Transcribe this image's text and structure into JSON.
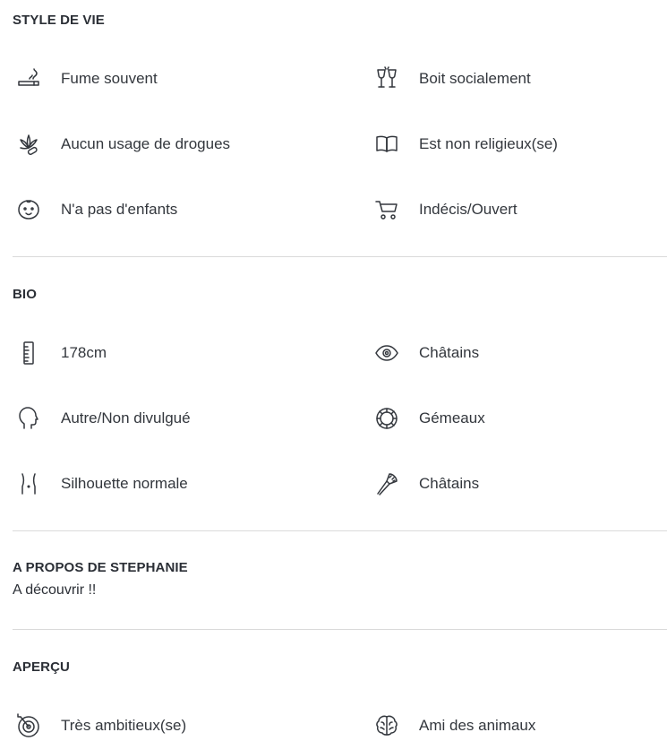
{
  "lifestyle": {
    "title": "STYLE DE VIE",
    "items": [
      {
        "icon": "cigarette-icon",
        "label": "Fume souvent"
      },
      {
        "icon": "wine-glasses-icon",
        "label": "Boit socialement"
      },
      {
        "icon": "cannabis-leaf-icon",
        "label": "Aucun usage de drogues"
      },
      {
        "icon": "open-book-icon",
        "label": "Est non religieux(se)"
      },
      {
        "icon": "baby-face-icon",
        "label": "N'a pas d'enfants"
      },
      {
        "icon": "stroller-icon",
        "label": "Indécis/Ouvert"
      }
    ]
  },
  "bio": {
    "title": "BIO",
    "items": [
      {
        "icon": "ruler-icon",
        "label": "178cm"
      },
      {
        "icon": "eye-icon",
        "label": "Châtains"
      },
      {
        "icon": "head-profile-icon",
        "label": "Autre/Non divulgué"
      },
      {
        "icon": "zodiac-wheel-icon",
        "label": "Gémeaux"
      },
      {
        "icon": "torso-icon",
        "label": "Silhouette normale"
      },
      {
        "icon": "hairbrush-icon",
        "label": "Châtains"
      }
    ]
  },
  "about": {
    "title": "A PROPOS DE STEPHANIE",
    "text": "A découvrir !!"
  },
  "overview": {
    "title": "APERÇU",
    "items": [
      {
        "icon": "target-icon",
        "label": "Très ambitieux(se)"
      },
      {
        "icon": "brain-icon",
        "label": "Ami des animaux"
      }
    ]
  }
}
